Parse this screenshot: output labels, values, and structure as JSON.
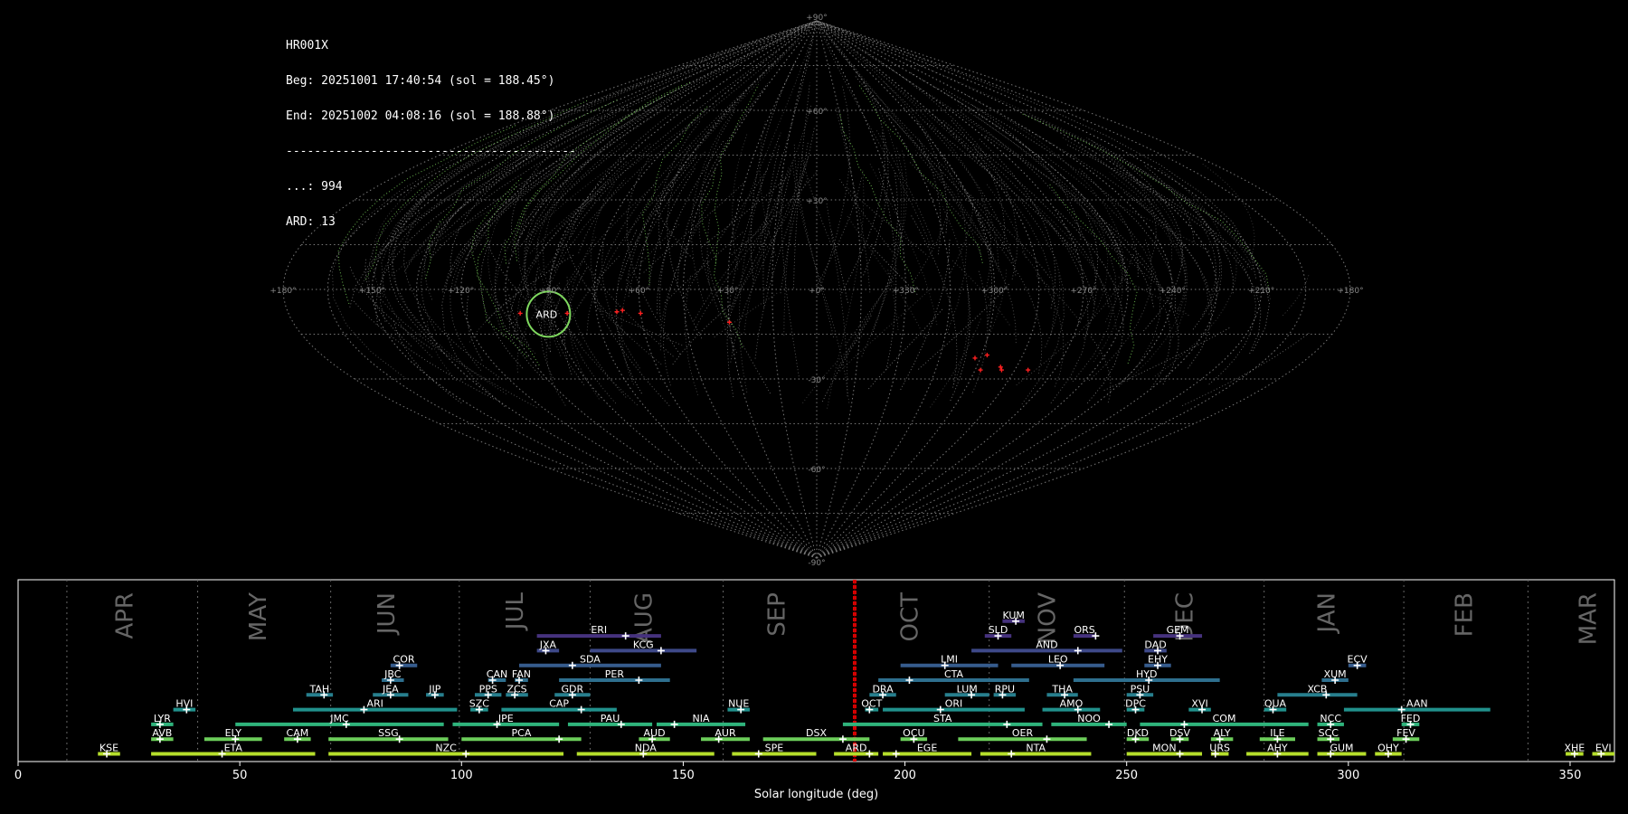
{
  "info": {
    "camera": "HR001X",
    "begin": "Beg: 20251001 17:40:54 (sol = 188.45°)",
    "end": "End: 20251002 04:08:16 (sol = 188.88°)",
    "separator": "-----------------------------------------",
    "sporadic": "...: 994",
    "ard": "ARD: 13"
  },
  "sky": {
    "projection": "sinusoidal",
    "lon_labels": [
      "+180°",
      "+150°",
      "+120°",
      "+90°",
      "+60°",
      "+30°",
      "+0°",
      "+330°",
      "+300°",
      "+270°",
      "+240°",
      "+210°",
      "+180°"
    ],
    "lat_labels": [
      "+90°",
      "+60°",
      "+30°",
      "-30°",
      "-60°",
      "-90°"
    ],
    "highlight_shower": "ARD",
    "highlight_color": "#7fd95f",
    "meteor_color_sporadic": "#b0b0b0",
    "meteor_color_ard": "#7fd95f",
    "radiant_color": "#ff2020"
  },
  "chart_data": {
    "type": "timeline",
    "xlabel": "Solar longitude (deg)",
    "xlim": [
      0,
      360
    ],
    "xticks": [
      0,
      50,
      100,
      150,
      200,
      250,
      300,
      350
    ],
    "current_sol": [
      188.45,
      188.88
    ],
    "current_sol_color": "#ff0000",
    "month_labels": [
      {
        "name": "APR",
        "sol": 24
      },
      {
        "name": "MAY",
        "sol": 54
      },
      {
        "name": "JUN",
        "sol": 83
      },
      {
        "name": "JUL",
        "sol": 112
      },
      {
        "name": "AUG",
        "sol": 141
      },
      {
        "name": "SEP",
        "sol": 171
      },
      {
        "name": "OCT",
        "sol": 201
      },
      {
        "name": "NOV",
        "sol": 232
      },
      {
        "name": "DEC",
        "sol": 263
      },
      {
        "name": "JAN",
        "sol": 295
      },
      {
        "name": "FEB",
        "sol": 326
      },
      {
        "name": "MAR",
        "sol": 354
      }
    ],
    "month_boundaries": [
      11,
      40.5,
      70.5,
      99.5,
      129,
      159,
      188.5,
      219,
      249.5,
      281,
      312.5,
      340.5
    ],
    "showers": [
      {
        "code": "KUM",
        "row": 12,
        "start": 222,
        "end": 227,
        "peak": 225,
        "color": "#46327e"
      },
      {
        "code": "ERI",
        "row": 11,
        "start": 117,
        "end": 145,
        "peak": 137,
        "color": "#46327e"
      },
      {
        "code": "SLD",
        "row": 11,
        "start": 218,
        "end": 224,
        "peak": 221,
        "color": "#46327e"
      },
      {
        "code": "ORS",
        "row": 11,
        "start": 238,
        "end": 243,
        "peak": 243,
        "color": "#46327e"
      },
      {
        "code": "GEM",
        "row": 11,
        "start": 256,
        "end": 267,
        "peak": 262,
        "color": "#46327e"
      },
      {
        "code": "JXA",
        "row": 10,
        "start": 117,
        "end": 122,
        "peak": 119,
        "color": "#3e4989"
      },
      {
        "code": "KCG",
        "row": 10,
        "start": 129,
        "end": 153,
        "peak": 145,
        "color": "#3e4989"
      },
      {
        "code": "AND",
        "row": 10,
        "start": 215,
        "end": 249,
        "peak": 239,
        "color": "#3e4989"
      },
      {
        "code": "DAD",
        "row": 10,
        "start": 254,
        "end": 259,
        "peak": 257,
        "color": "#3e4989"
      },
      {
        "code": "COR",
        "row": 9,
        "start": 84,
        "end": 90,
        "peak": 86,
        "color": "#365c8d"
      },
      {
        "code": "SDA",
        "row": 9,
        "start": 113,
        "end": 145,
        "peak": 125,
        "color": "#365c8d"
      },
      {
        "code": "LMI",
        "row": 9,
        "start": 199,
        "end": 221,
        "peak": 209,
        "color": "#365c8d"
      },
      {
        "code": "LEO",
        "row": 9,
        "start": 224,
        "end": 245,
        "peak": 235,
        "color": "#365c8d"
      },
      {
        "code": "EHY",
        "row": 9,
        "start": 254,
        "end": 260,
        "peak": 257,
        "color": "#365c8d"
      },
      {
        "code": "ECV",
        "row": 9,
        "start": 300,
        "end": 304,
        "peak": 302,
        "color": "#365c8d"
      },
      {
        "code": "JBC",
        "row": 8,
        "start": 82,
        "end": 87,
        "peak": 84,
        "color": "#2e6f8e"
      },
      {
        "code": "CAN",
        "row": 8,
        "start": 106,
        "end": 110,
        "peak": 107,
        "color": "#2e6f8e"
      },
      {
        "code": "FAN",
        "row": 8,
        "start": 112,
        "end": 115,
        "peak": 113,
        "color": "#2e6f8e"
      },
      {
        "code": "PER",
        "row": 8,
        "start": 122,
        "end": 147,
        "peak": 140,
        "color": "#2e6f8e"
      },
      {
        "code": "CTA",
        "row": 8,
        "start": 194,
        "end": 228,
        "peak": 201,
        "color": "#2e6f8e"
      },
      {
        "code": "HYD",
        "row": 8,
        "start": 238,
        "end": 271,
        "peak": 255,
        "color": "#2e6f8e"
      },
      {
        "code": "XUM",
        "row": 8,
        "start": 294,
        "end": 300,
        "peak": 297,
        "color": "#2e6f8e"
      },
      {
        "code": "TAH",
        "row": 7,
        "start": 65,
        "end": 71,
        "peak": 69,
        "color": "#277f8e"
      },
      {
        "code": "JEA",
        "row": 7,
        "start": 80,
        "end": 88,
        "peak": 84,
        "color": "#277f8e"
      },
      {
        "code": "JIP",
        "row": 7,
        "start": 92,
        "end": 96,
        "peak": 94,
        "color": "#277f8e"
      },
      {
        "code": "PPS",
        "row": 7,
        "start": 103,
        "end": 109,
        "peak": 106,
        "color": "#277f8e"
      },
      {
        "code": "ZCS",
        "row": 7,
        "start": 110,
        "end": 115,
        "peak": 112,
        "color": "#277f8e"
      },
      {
        "code": "GDR",
        "row": 7,
        "start": 121,
        "end": 129,
        "peak": 125,
        "color": "#277f8e"
      },
      {
        "code": "DRA",
        "row": 7,
        "start": 192,
        "end": 198,
        "peak": 195,
        "color": "#277f8e"
      },
      {
        "code": "LUM",
        "row": 7,
        "start": 209,
        "end": 219,
        "peak": 215,
        "color": "#277f8e"
      },
      {
        "code": "RPU",
        "row": 7,
        "start": 220,
        "end": 225,
        "peak": 222,
        "color": "#277f8e"
      },
      {
        "code": "THA",
        "row": 7,
        "start": 232,
        "end": 239,
        "peak": 236,
        "color": "#277f8e"
      },
      {
        "code": "PSU",
        "row": 7,
        "start": 250,
        "end": 256,
        "peak": 253,
        "color": "#277f8e"
      },
      {
        "code": "XCB",
        "row": 7,
        "start": 284,
        "end": 302,
        "peak": 295,
        "color": "#277f8e"
      },
      {
        "code": "HVI",
        "row": 6,
        "start": 35,
        "end": 40,
        "peak": 38,
        "color": "#21918c"
      },
      {
        "code": "ARI",
        "row": 6,
        "start": 62,
        "end": 99,
        "peak": 78,
        "color": "#21918c"
      },
      {
        "code": "SZC",
        "row": 6,
        "start": 102,
        "end": 106,
        "peak": 104,
        "color": "#21918c"
      },
      {
        "code": "CAP",
        "row": 6,
        "start": 109,
        "end": 135,
        "peak": 127,
        "color": "#21918c"
      },
      {
        "code": "NUE",
        "row": 6,
        "start": 160,
        "end": 165,
        "peak": 163,
        "color": "#21918c"
      },
      {
        "code": "OCT",
        "row": 6,
        "start": 191,
        "end": 194,
        "peak": 192,
        "color": "#21918c"
      },
      {
        "code": "ORI",
        "row": 6,
        "start": 195,
        "end": 227,
        "peak": 208,
        "color": "#21918c"
      },
      {
        "code": "AMO",
        "row": 6,
        "start": 231,
        "end": 244,
        "peak": 239,
        "color": "#21918c"
      },
      {
        "code": "DPC",
        "row": 6,
        "start": 250,
        "end": 254,
        "peak": 252,
        "color": "#21918c"
      },
      {
        "code": "XVI",
        "row": 6,
        "start": 264,
        "end": 269,
        "peak": 267,
        "color": "#21918c"
      },
      {
        "code": "QUA",
        "row": 6,
        "start": 281,
        "end": 286,
        "peak": 283,
        "color": "#21918c"
      },
      {
        "code": "AAN",
        "row": 6,
        "start": 299,
        "end": 332,
        "peak": 312,
        "color": "#21918c"
      },
      {
        "code": "LYR",
        "row": 5,
        "start": 30,
        "end": 35,
        "peak": 32,
        "color": "#2fb47c"
      },
      {
        "code": "JMC",
        "row": 5,
        "start": 49,
        "end": 96,
        "peak": 74,
        "color": "#2fb47c"
      },
      {
        "code": "JPE",
        "row": 5,
        "start": 98,
        "end": 122,
        "peak": 108,
        "color": "#2fb47c"
      },
      {
        "code": "PAU",
        "row": 5,
        "start": 124,
        "end": 143,
        "peak": 136,
        "color": "#2fb47c"
      },
      {
        "code": "NIA",
        "row": 5,
        "start": 144,
        "end": 164,
        "peak": 148,
        "color": "#2fb47c"
      },
      {
        "code": "STA",
        "row": 5,
        "start": 186,
        "end": 231,
        "peak": 223,
        "color": "#2fb47c"
      },
      {
        "code": "NOO",
        "row": 5,
        "start": 233,
        "end": 250,
        "peak": 246,
        "color": "#2fb47c"
      },
      {
        "code": "COM",
        "row": 5,
        "start": 253,
        "end": 291,
        "peak": 263,
        "color": "#2fb47c"
      },
      {
        "code": "NCC",
        "row": 5,
        "start": 293,
        "end": 299,
        "peak": 296,
        "color": "#2fb47c"
      },
      {
        "code": "FED",
        "row": 5,
        "start": 312,
        "end": 316,
        "peak": 314,
        "color": "#2fb47c"
      },
      {
        "code": "AVB",
        "row": 4,
        "start": 30,
        "end": 35,
        "peak": 32,
        "color": "#6ccd5a"
      },
      {
        "code": "ELY",
        "row": 4,
        "start": 42,
        "end": 55,
        "peak": 49,
        "color": "#6ccd5a"
      },
      {
        "code": "CAM",
        "row": 4,
        "start": 60,
        "end": 66,
        "peak": 63,
        "color": "#6ccd5a"
      },
      {
        "code": "SSG",
        "row": 4,
        "start": 70,
        "end": 97,
        "peak": 86,
        "color": "#6ccd5a"
      },
      {
        "code": "PCA",
        "row": 4,
        "start": 100,
        "end": 127,
        "peak": 122,
        "color": "#6ccd5a"
      },
      {
        "code": "AUD",
        "row": 4,
        "start": 140,
        "end": 147,
        "peak": 143,
        "color": "#6ccd5a"
      },
      {
        "code": "AUR",
        "row": 4,
        "start": 154,
        "end": 165,
        "peak": 158,
        "color": "#6ccd5a"
      },
      {
        "code": "DSX",
        "row": 4,
        "start": 168,
        "end": 192,
        "peak": 186,
        "color": "#6ccd5a"
      },
      {
        "code": "OCU",
        "row": 4,
        "start": 199,
        "end": 205,
        "peak": 202,
        "color": "#6ccd5a"
      },
      {
        "code": "OER",
        "row": 4,
        "start": 212,
        "end": 241,
        "peak": 232,
        "color": "#6ccd5a"
      },
      {
        "code": "DKD",
        "row": 4,
        "start": 250,
        "end": 255,
        "peak": 252,
        "color": "#6ccd5a"
      },
      {
        "code": "DSV",
        "row": 4,
        "start": 260,
        "end": 264,
        "peak": 262,
        "color": "#6ccd5a"
      },
      {
        "code": "ALY",
        "row": 4,
        "start": 269,
        "end": 274,
        "peak": 271,
        "color": "#6ccd5a"
      },
      {
        "code": "ILE",
        "row": 4,
        "start": 280,
        "end": 288,
        "peak": 284,
        "color": "#6ccd5a"
      },
      {
        "code": "SCC",
        "row": 4,
        "start": 293,
        "end": 298,
        "peak": 296,
        "color": "#6ccd5a"
      },
      {
        "code": "FEV",
        "row": 4,
        "start": 310,
        "end": 316,
        "peak": 313,
        "color": "#6ccd5a"
      },
      {
        "code": "KSE",
        "row": 3,
        "start": 18,
        "end": 23,
        "peak": 20,
        "color": "#b5de2b"
      },
      {
        "code": "ETA",
        "row": 3,
        "start": 30,
        "end": 67,
        "peak": 46,
        "color": "#b5de2b"
      },
      {
        "code": "NZC",
        "row": 3,
        "start": 70,
        "end": 123,
        "peak": 101,
        "color": "#b5de2b"
      },
      {
        "code": "NDA",
        "row": 3,
        "start": 126,
        "end": 157,
        "peak": 141,
        "color": "#b5de2b"
      },
      {
        "code": "SPE",
        "row": 3,
        "start": 161,
        "end": 180,
        "peak": 167,
        "color": "#b5de2b"
      },
      {
        "code": "ARD",
        "row": 3,
        "start": 184,
        "end": 194,
        "peak": 192,
        "color": "#b5de2b"
      },
      {
        "code": "EGE",
        "row": 3,
        "start": 195,
        "end": 215,
        "peak": 198,
        "color": "#b5de2b"
      },
      {
        "code": "NTA",
        "row": 3,
        "start": 217,
        "end": 242,
        "peak": 224,
        "color": "#b5de2b"
      },
      {
        "code": "MON",
        "row": 3,
        "start": 250,
        "end": 267,
        "peak": 262,
        "color": "#b5de2b"
      },
      {
        "code": "URS",
        "row": 3,
        "start": 269,
        "end": 273,
        "peak": 270,
        "color": "#b5de2b"
      },
      {
        "code": "AHY",
        "row": 3,
        "start": 277,
        "end": 291,
        "peak": 284,
        "color": "#b5de2b"
      },
      {
        "code": "GUM",
        "row": 3,
        "start": 293,
        "end": 304,
        "peak": 296,
        "color": "#b5de2b"
      },
      {
        "code": "OHY",
        "row": 3,
        "start": 306,
        "end": 312,
        "peak": 309,
        "color": "#b5de2b"
      },
      {
        "code": "XHE",
        "row": 3,
        "start": 349,
        "end": 353,
        "peak": 351,
        "color": "#b5de2b"
      },
      {
        "code": "EVI",
        "row": 3,
        "start": 355,
        "end": 360,
        "peak": 357,
        "color": "#b5de2b"
      }
    ]
  }
}
